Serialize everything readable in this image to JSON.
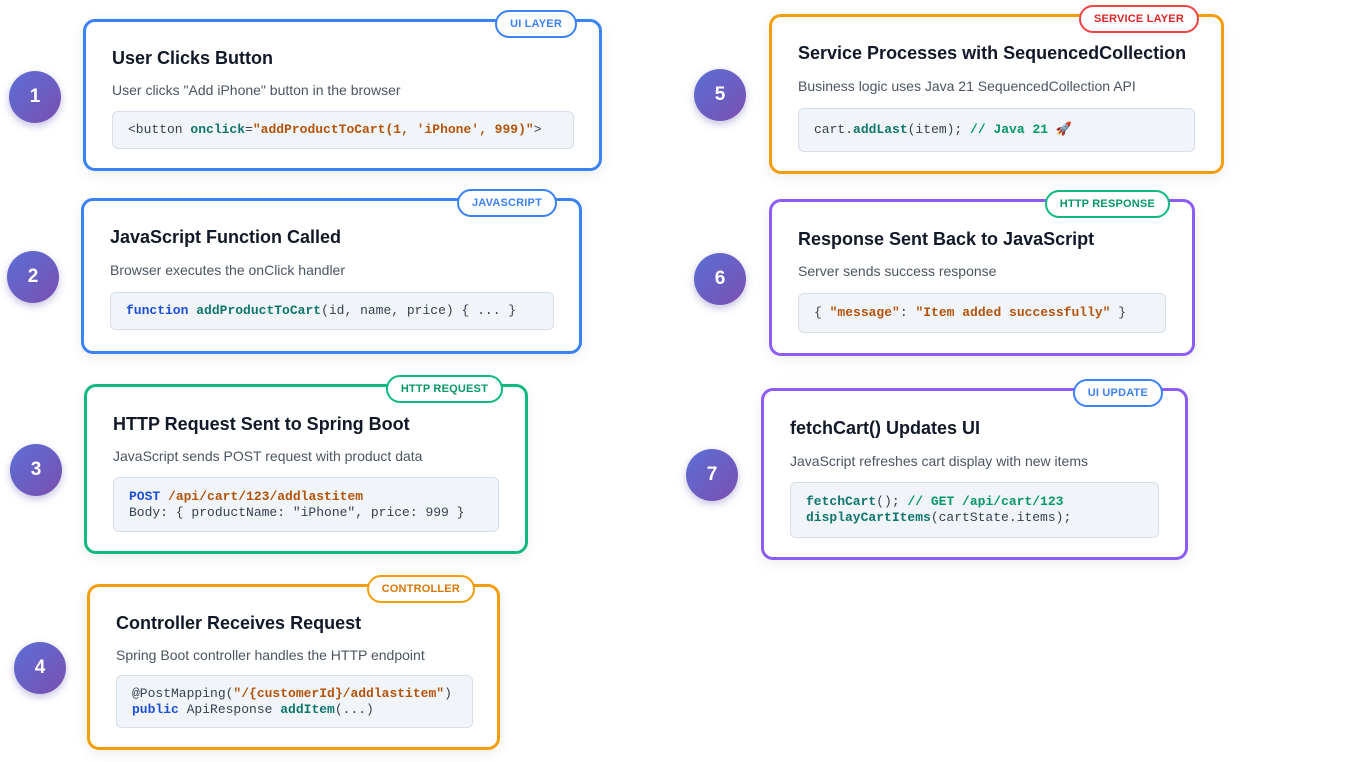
{
  "steps": [
    {
      "number": "1",
      "badge": "UI LAYER",
      "title": "User Clicks Button",
      "description": "User clicks \"Add iPhone\" button in the browser",
      "code": [
        "<button ",
        "onclick",
        "=",
        "\"addProductToCart(1, 'iPhone', 999)\"",
        ">"
      ]
    },
    {
      "number": "2",
      "badge": "JAVASCRIPT",
      "title": "JavaScript Function Called",
      "description": "Browser executes the onClick handler",
      "code": [
        "function",
        " ",
        "addProductToCart",
        "(id, name, price) { ... }"
      ]
    },
    {
      "number": "3",
      "badge": "HTTP REQUEST",
      "title": "HTTP Request Sent to Spring Boot",
      "description": "JavaScript sends POST request with product data",
      "code": [
        "POST",
        " ",
        "/api/cart/123/addlastitem",
        "Body: { productName: \"iPhone\", price: 999 }"
      ]
    },
    {
      "number": "4",
      "badge": "CONTROLLER",
      "title": "Controller Receives Request",
      "description": "Spring Boot controller handles the HTTP endpoint",
      "code": [
        "@PostMapping(",
        "\"/{customerId}/addlastitem\"",
        ")",
        "public",
        " ApiResponse ",
        "addItem",
        "(...)"
      ]
    },
    {
      "number": "5",
      "badge": "SERVICE LAYER",
      "title": "Service Processes with SequencedCollection",
      "description": "Business logic uses Java 21 SequencedCollection API",
      "code": [
        "cart.",
        "addLast",
        "(item); ",
        "// Java 21 🚀"
      ]
    },
    {
      "number": "6",
      "badge": "HTTP RESPONSE",
      "title": "Response Sent Back to JavaScript",
      "description": "Server sends success response",
      "code": [
        "{ ",
        "\"message\"",
        ": ",
        "\"Item added successfully\"",
        " }"
      ]
    },
    {
      "number": "7",
      "badge": "UI UPDATE",
      "title": "fetchCart() Updates UI",
      "description": "JavaScript refreshes cart display with new items",
      "code": [
        "fetchCart",
        "(); ",
        "// GET /api/cart/123",
        "displayCartItems",
        "(cartState.items);"
      ]
    }
  ],
  "colors": {
    "blue": "#3b82f6",
    "green": "#10b981",
    "orange": "#f59e0b",
    "purple": "#8b5cf6",
    "red": "#ef4444",
    "circle": "#6a5fc4"
  }
}
